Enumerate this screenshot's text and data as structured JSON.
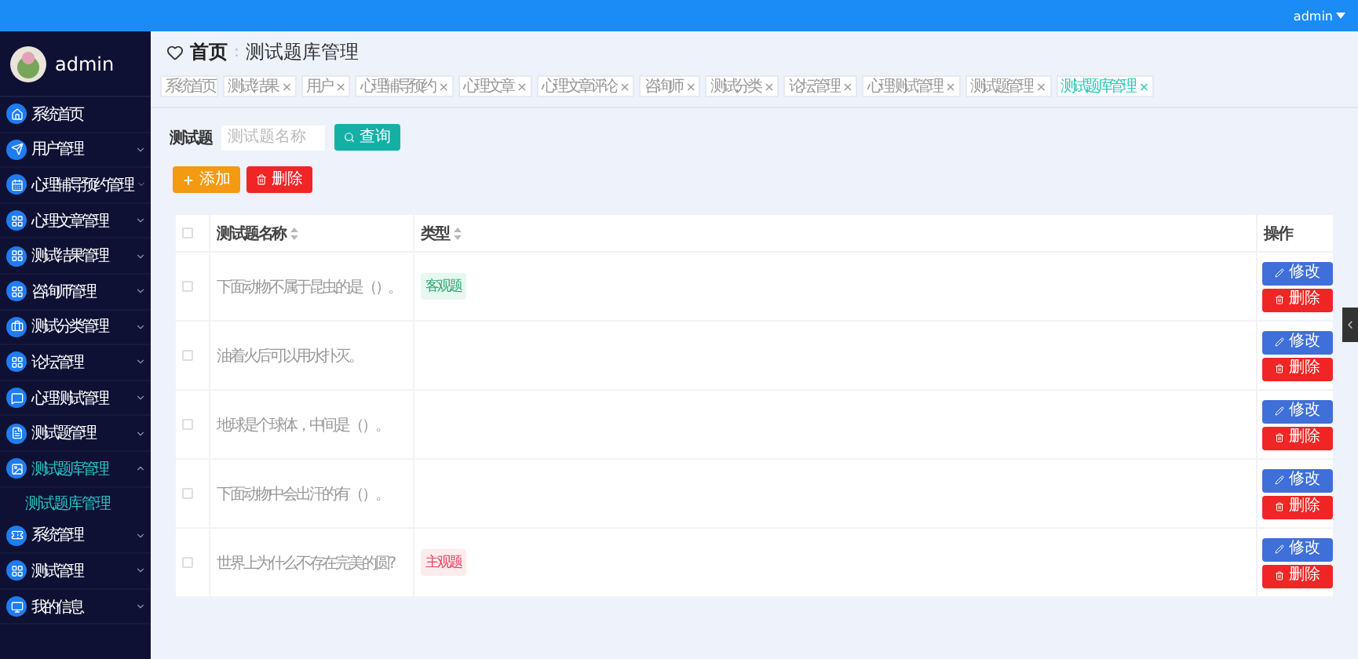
{
  "top_bar": {
    "user": "admin"
  },
  "sidebar": {
    "user": "admin",
    "items": [
      {
        "label": "系统首页",
        "selected": false
      },
      {
        "label": "用户管理",
        "expanded": false,
        "selected": false
      },
      {
        "label": "心理辅导预约管理",
        "expanded": false,
        "selected": false
      },
      {
        "label": "心理文章管理",
        "expanded": false,
        "selected": false
      },
      {
        "label": "测试结果管理",
        "expanded": false,
        "selected": false
      },
      {
        "label": "咨询师管理",
        "expanded": false,
        "selected": false
      },
      {
        "label": "测试分类管理",
        "expanded": false,
        "selected": false
      },
      {
        "label": "论坛管理",
        "expanded": false,
        "selected": false
      },
      {
        "label": "心理测试管理",
        "expanded": false,
        "selected": false
      },
      {
        "label": "测试题管理",
        "expanded": false,
        "selected": false
      },
      {
        "label": "测试题库管理",
        "expanded": true,
        "selected": true,
        "children": [
          {
            "label": "测试题库管理",
            "selected": true
          }
        ]
      },
      {
        "label": "系统管理",
        "expanded": false,
        "selected": false
      },
      {
        "label": "测试管理",
        "expanded": false,
        "selected": false
      },
      {
        "label": "我的信息",
        "expanded": false,
        "selected": false
      }
    ]
  },
  "breadcrumb": {
    "home": "首页",
    "separator": ":",
    "current": "测试题库管理"
  },
  "tabs": [
    {
      "label": "系统首页",
      "selected": false
    },
    {
      "label": "测试结果",
      "close": "×",
      "selected": false
    },
    {
      "label": "用户",
      "close": "×",
      "selected": false
    },
    {
      "label": "心理辅导预约",
      "close": "×",
      "selected": false
    },
    {
      "label": "心理文章",
      "close": "×",
      "selected": false
    },
    {
      "label": "心理文章评论",
      "close": "×",
      "selected": false
    },
    {
      "label": "咨询师",
      "close": "×",
      "selected": false
    },
    {
      "label": "测试分类",
      "close": "×",
      "selected": false
    },
    {
      "label": "论坛管理",
      "close": "×",
      "selected": false
    },
    {
      "label": "心理测试管理",
      "close": "×",
      "selected": false
    },
    {
      "label": "测试题管理",
      "close": "×",
      "selected": false
    },
    {
      "label": "测试题库管理",
      "close": "×",
      "selected": true
    }
  ],
  "search": {
    "label": "测试题",
    "placeholder": "测试题名称",
    "button": "查询"
  },
  "actions": {
    "add": "添加",
    "delete": "删除"
  },
  "table": {
    "select_all": false,
    "columns": [
      "测试题名称",
      "类型",
      "操作"
    ],
    "rows": [
      {
        "checked": false,
        "name": "下面动物不属于昆虫的是（）。",
        "type": {
          "label": "客观题",
          "kind": "objective"
        },
        "edit": "修改",
        "delete": "删除"
      },
      {
        "checked": false,
        "name": "油着火后可以用水扑灭。",
        "edit": "修改",
        "delete": "删除"
      },
      {
        "checked": false,
        "name": "地球是个球体，中间是（）。",
        "edit": "修改",
        "delete": "删除"
      },
      {
        "checked": false,
        "name": "下面动物中会出汗的有（）。",
        "edit": "修改",
        "delete": "删除"
      },
      {
        "checked": false,
        "name": "世界上为什么不存在完美的圆?",
        "type": {
          "label": "主观题",
          "kind": "subjective"
        },
        "edit": "修改",
        "delete": "删除"
      }
    ]
  }
}
